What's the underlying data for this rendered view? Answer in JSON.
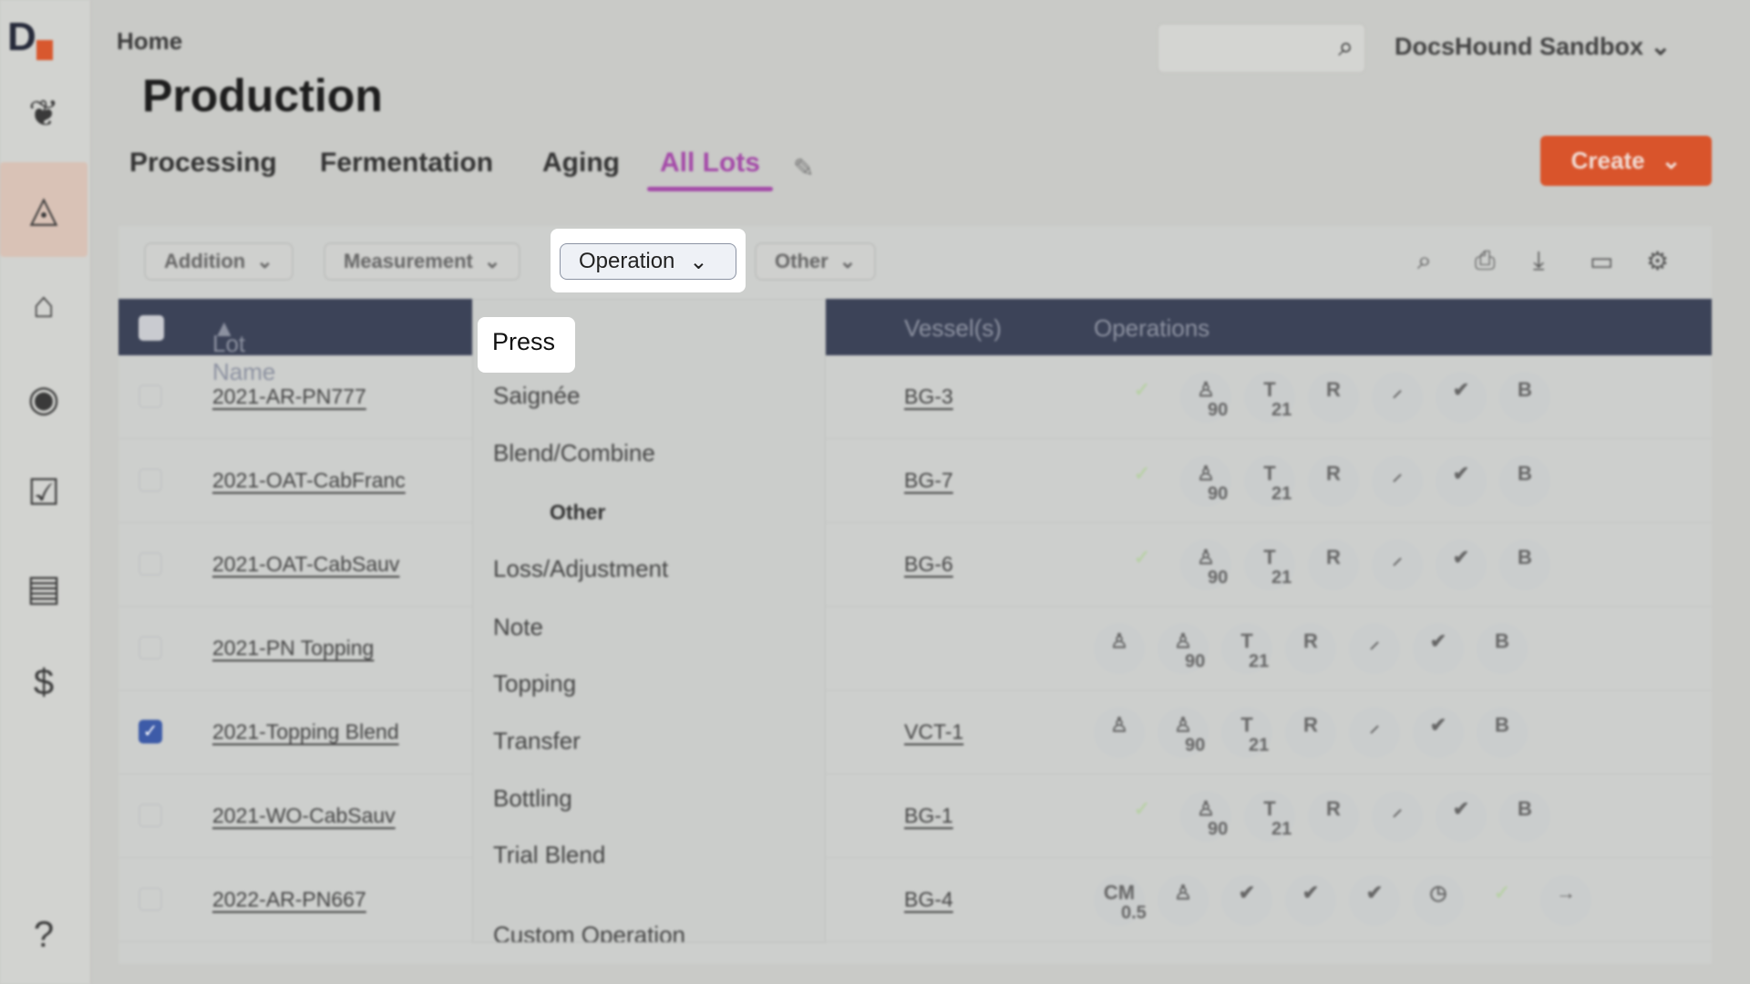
{
  "sidebar": {
    "logo": "DH",
    "items": [
      {
        "name": "leaf",
        "glyph": "❦"
      },
      {
        "name": "drop",
        "glyph": "💧",
        "active": true
      },
      {
        "name": "warehouse",
        "glyph": "⌂"
      },
      {
        "name": "basket",
        "glyph": "◉"
      },
      {
        "name": "clipboard-check",
        "glyph": "☑"
      },
      {
        "name": "certificate",
        "glyph": "▤"
      },
      {
        "name": "dollar-search",
        "glyph": "$"
      }
    ],
    "help": "?"
  },
  "header": {
    "breadcrumb": "Home",
    "title": "Production",
    "search_placeholder": "",
    "org": "DocsHound Sandbox",
    "create": "Create"
  },
  "tabs": [
    "Processing",
    "Fermentation",
    "Aging",
    "All Lots"
  ],
  "filters": [
    "Addition",
    "Measurement",
    "Operation",
    "Other"
  ],
  "table": {
    "columns": {
      "lot": "Lot Name",
      "vessel": "Vessel(s)",
      "ops": "Operations"
    },
    "rows": [
      {
        "lot": "2021-AR-PN777",
        "vessel": "BG-3",
        "checked": false,
        "ops": [
          [
            "✓",
            ""
          ],
          [
            "♙",
            "90"
          ],
          [
            "T",
            "21"
          ],
          [
            "R",
            ""
          ],
          [
            "⸝",
            ""
          ],
          [
            "✔",
            ""
          ],
          [
            "B",
            ""
          ]
        ]
      },
      {
        "lot": "2021-OAT-CabFranc",
        "vessel": "BG-7",
        "checked": false,
        "ops": [
          [
            "✓",
            ""
          ],
          [
            "♙",
            "90"
          ],
          [
            "T",
            "21"
          ],
          [
            "R",
            ""
          ],
          [
            "⸝",
            ""
          ],
          [
            "✔",
            ""
          ],
          [
            "B",
            ""
          ]
        ]
      },
      {
        "lot": "2021-OAT-CabSauv",
        "vessel": "BG-6",
        "checked": false,
        "ops": [
          [
            "✓",
            ""
          ],
          [
            "♙",
            "90"
          ],
          [
            "T",
            "21"
          ],
          [
            "R",
            ""
          ],
          [
            "⸝",
            ""
          ],
          [
            "✔",
            ""
          ],
          [
            "B",
            ""
          ]
        ]
      },
      {
        "lot": "2021-PN Topping",
        "vessel": "",
        "checked": false,
        "ops": [
          [
            "♙",
            ""
          ],
          [
            "♙",
            "90"
          ],
          [
            "T",
            "21"
          ],
          [
            "R",
            ""
          ],
          [
            "⸝",
            ""
          ],
          [
            "✔",
            ""
          ],
          [
            "B",
            ""
          ]
        ]
      },
      {
        "lot": "2021-Topping Blend",
        "vessel": "VCT-1",
        "checked": true,
        "ops": [
          [
            "♙",
            ""
          ],
          [
            "♙",
            "90"
          ],
          [
            "T",
            "21"
          ],
          [
            "R",
            ""
          ],
          [
            "⸝",
            ""
          ],
          [
            "✔",
            ""
          ],
          [
            "B",
            ""
          ]
        ]
      },
      {
        "lot": "2021-WO-CabSauv",
        "vessel": "BG-1",
        "checked": false,
        "ops": [
          [
            "✓",
            ""
          ],
          [
            "♙",
            "90"
          ],
          [
            "T",
            "21"
          ],
          [
            "R",
            ""
          ],
          [
            "⸝",
            ""
          ],
          [
            "✔",
            ""
          ],
          [
            "B",
            ""
          ]
        ]
      },
      {
        "lot": "2022-AR-PN667",
        "vessel": "BG-4",
        "checked": false,
        "ops": [
          [
            "CM",
            "0.5"
          ],
          [
            "♙",
            ""
          ],
          [
            "✔",
            ""
          ],
          [
            "✔",
            ""
          ],
          [
            "✔",
            ""
          ],
          [
            "◷",
            ""
          ],
          [
            "✓",
            ""
          ],
          [
            "→",
            ""
          ]
        ]
      }
    ]
  },
  "dropdown": {
    "items": [
      "Press",
      "Saignée",
      "Blend/Combine",
      "Other",
      "Loss/Adjustment",
      "Note",
      "Topping",
      "Transfer",
      "Bottling",
      "Trial Blend",
      "Custom Operation"
    ],
    "group_header": "Other"
  },
  "colors": {
    "accent": "#a44aa8",
    "create": "#d9542b",
    "table_header": "#3c4358"
  }
}
